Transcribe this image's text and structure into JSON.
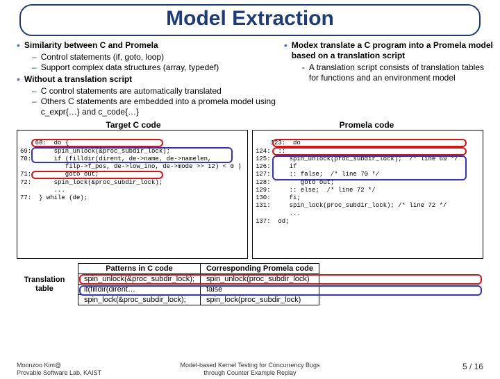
{
  "title": "Model Extraction",
  "left": {
    "b1": "Similarity between C and Promela",
    "b1s1": "Control statements (if, goto, loop)",
    "b1s2": "Support complex data structures (array, typedef)",
    "b2": "Without a translation script",
    "b2s1": "C control statements are automatically translated",
    "b2s2": "Others C statements are embedded into a promela model using c_expr{…} and c_code{…}"
  },
  "right": {
    "b1": "Modex  translate a C program into a Promela model based on a translation script",
    "b1s1": "A translation script consists of translation tables for functions and an environment model"
  },
  "codeHeaders": {
    "left": "Target C code",
    "right": "Promela code"
  },
  "codeLeft": "68:  do {\n69:      spin_unlock(&proc_subdir_lock);\n70:      if (filldir(dirent, de->name, de->namelen,\n            filp->f_pos, de->low_ino, de->mode >> 12) < 0 )\n71:         goto out;\n72:      spin_lock(&proc_subdir_lock);\n         ...\n77:  } while (de);",
  "codeRight": "123:  do\n124:  ::\n125:     spin_unlock(proc_subdir_lock);  /* line 69 */\n126:     if\n127:     :: false;  /* line 70 */\n128:        goto out;\n129:     :: else;  /* line 72 */\n130:     fi;\n131:     spin_lock(proc_subdir_lock); /* line 72 */\n         ...\n137:  od;",
  "transLabel": "Translation table",
  "table": {
    "h1": "Patterns in C code",
    "h2": "Corresponding Promela code",
    "r1c1": "spin_unlock(&proc_subdir_lock);",
    "r1c2": "spin_unlock(proc_subdir_lock)",
    "r2c1": "if(filldir(dirent…",
    "r2c2": "false",
    "r3c1": "spin_lock(&proc_subdir_lock);",
    "r3c2": "spin_lock(proc_subdir_lock)"
  },
  "footer": {
    "left": "Moonzoo Kim@\nProvable Software Lab, KAIST",
    "center": "Model-based Kernel Testing for Concurrency Bugs\nthrough Counter Example Replay",
    "right": "5 / 16"
  }
}
